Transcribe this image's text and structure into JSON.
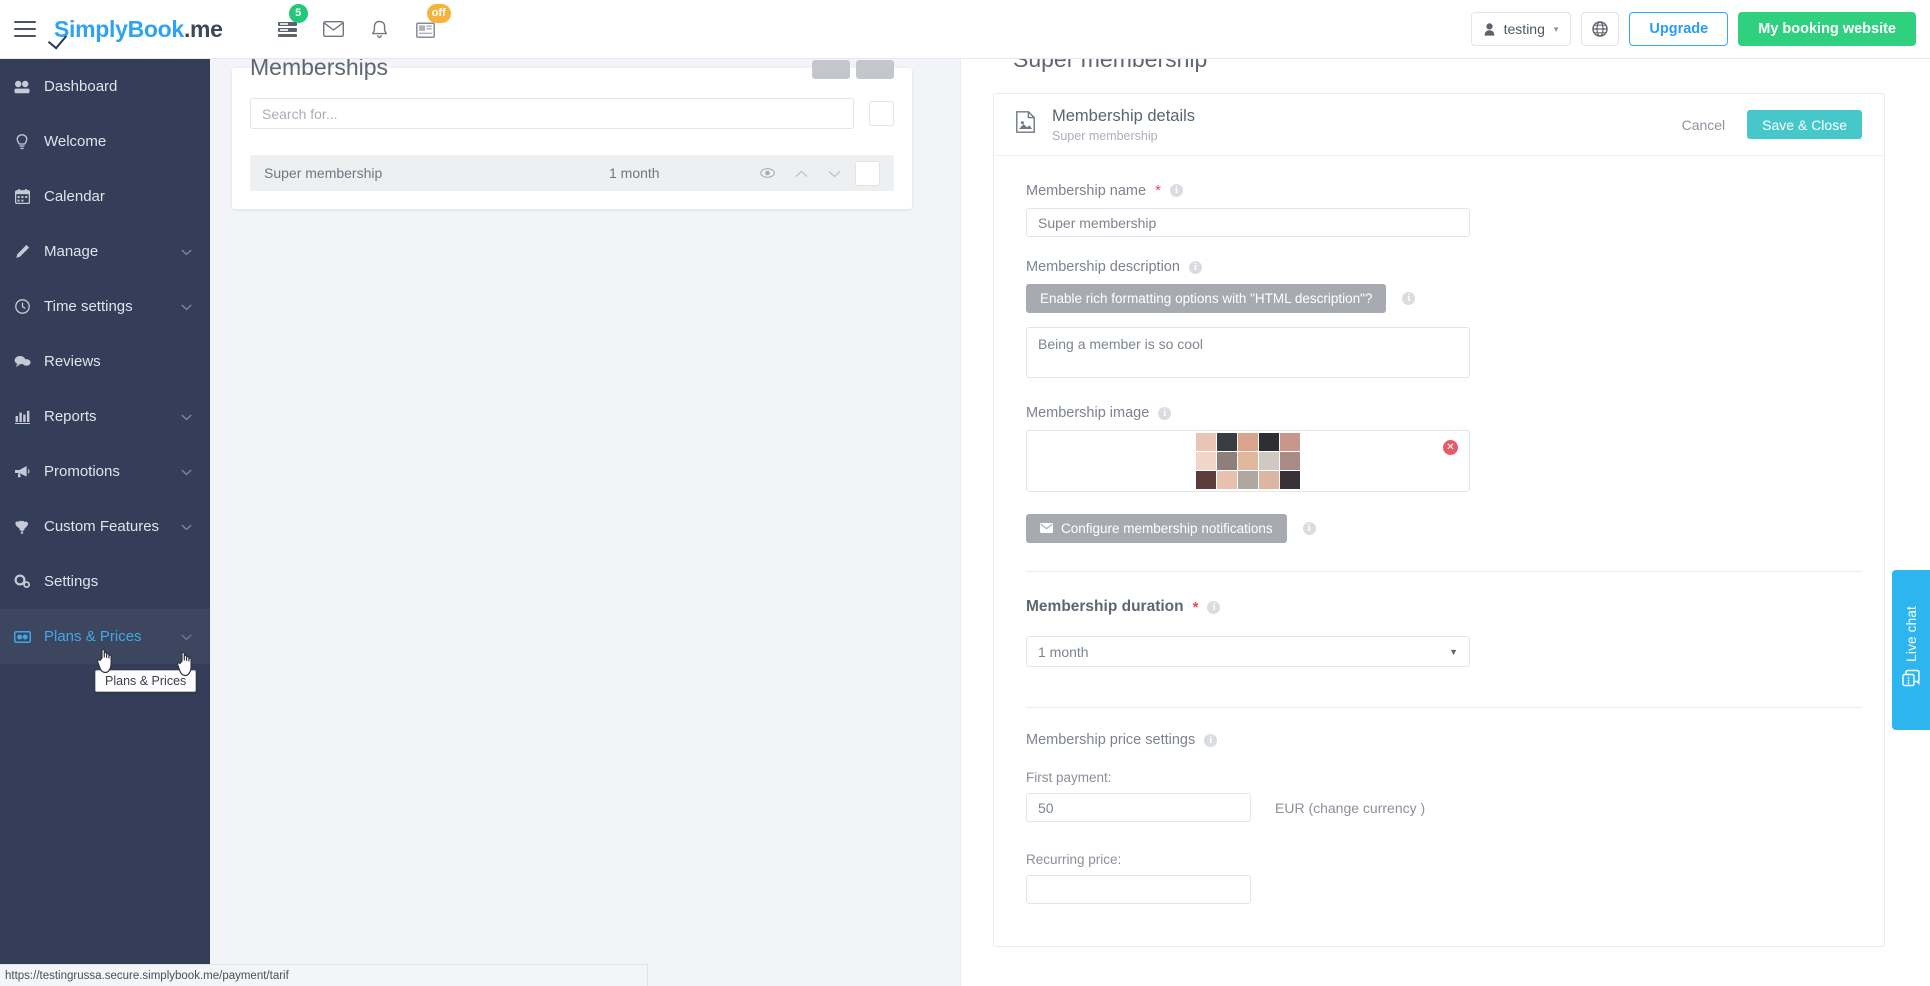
{
  "topbar": {
    "brand_blue": "imply",
    "brand_rest": "Book",
    "brand_suffix": ".me",
    "brand_prefix_s": "S",
    "icons": [
      {
        "name": "queue-icon",
        "badge": "5",
        "badge_color": "#21c87a"
      },
      {
        "name": "envelope-icon",
        "badge": "",
        "badge_color": ""
      },
      {
        "name": "bell-icon",
        "badge": "",
        "badge_color": ""
      },
      {
        "name": "news-icon",
        "badge": "off",
        "badge_color": "#f5b33c"
      }
    ],
    "user_label": "testing",
    "upgrade_label": "Upgrade",
    "booking_label": "My booking website",
    "accent_green": "#2fd07e",
    "accent_blue": "#2e9bf0"
  },
  "sidebar": {
    "items": [
      {
        "label": "Dashboard",
        "icon": "dashboard-icon",
        "has_chevron": false,
        "active": false
      },
      {
        "label": "Welcome",
        "icon": "bulb-icon",
        "has_chevron": false,
        "active": false
      },
      {
        "label": "Calendar",
        "icon": "calendar-icon",
        "has_chevron": false,
        "active": false
      },
      {
        "label": "Manage",
        "icon": "pencil-icon",
        "has_chevron": true,
        "active": false
      },
      {
        "label": "Time settings",
        "icon": "clock-icon",
        "has_chevron": true,
        "active": false
      },
      {
        "label": "Reviews",
        "icon": "chat-icon",
        "has_chevron": false,
        "active": false
      },
      {
        "label": "Reports",
        "icon": "bar-chart-icon",
        "has_chevron": true,
        "active": false
      },
      {
        "label": "Promotions",
        "icon": "megaphone-icon",
        "has_chevron": true,
        "active": false
      },
      {
        "label": "Custom Features",
        "icon": "puzzle-icon",
        "has_chevron": true,
        "active": false
      },
      {
        "label": "Settings",
        "icon": "gears-icon",
        "has_chevron": false,
        "active": false
      },
      {
        "label": "Plans & Prices",
        "icon": "card-icon",
        "has_chevron": true,
        "active": true
      }
    ],
    "tooltip": "Plans & Prices"
  },
  "memberships_panel": {
    "title": "Memberships",
    "search_placeholder": "Search for...",
    "columns": [
      "name",
      "duration"
    ],
    "rows": [
      {
        "name": "Super membership",
        "duration": "1 month"
      }
    ]
  },
  "detail": {
    "page_title": "Super membership",
    "card_title": "Membership details",
    "card_subtitle": "Super membership",
    "cancel_label": "Cancel",
    "save_label": "Save & Close",
    "save_color": "#46c7ca",
    "fields": {
      "name_label": "Membership name",
      "name_value": "Super membership",
      "description_label": "Membership description",
      "html_toggle_label": "Enable rich formatting options with \"HTML description\"?",
      "description_value": "Being a member is so cool",
      "image_label": "Membership image",
      "notifications_label": "Configure membership notifications",
      "duration_label": "Membership duration",
      "duration_value": "1 month",
      "price_settings_label": "Membership price settings",
      "first_payment_label": "First payment:",
      "first_payment_value": "50",
      "currency_text": "EUR (change currency )",
      "recurring_label": "Recurring price:"
    }
  },
  "livechat": {
    "label": "Live chat",
    "color": "#2db5f0"
  },
  "statusbar": {
    "url": "https://testingrussa.secure.simplybook.me/payment/tarif"
  }
}
